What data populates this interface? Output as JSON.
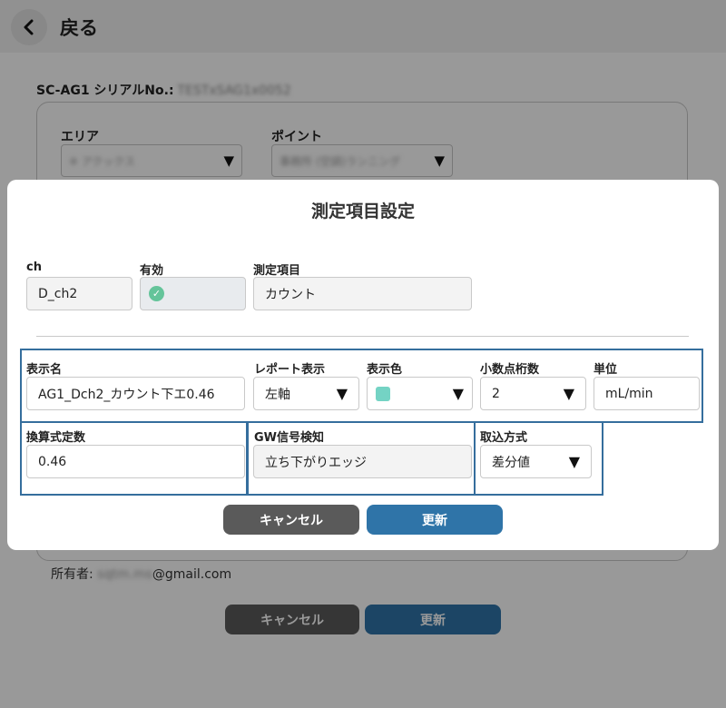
{
  "header": {
    "back_label": "戻る"
  },
  "background": {
    "serial_label": "SC-AG1 シリアルNo.:",
    "serial_value": "TESTxSAG1x0052",
    "area_label": "エリア",
    "area_value": "※ アクックス",
    "point_label": "ポイント",
    "point_value": "事務所 (空調)ランニング",
    "owner_label": "所有者:",
    "owner_local": "sqtm.ms",
    "owner_domain": "@gmail.com",
    "cancel_label": "キャンセル",
    "update_label": "更新"
  },
  "dialog": {
    "title": "測定項目設定",
    "ch": {
      "label": "ch",
      "value": "D_ch2"
    },
    "enabled": {
      "label": "有効",
      "checked": true
    },
    "item": {
      "label": "測定項目",
      "value": "カウント"
    },
    "display_name": {
      "label": "表示名",
      "value": "AG1_Dch2_カウント下エ0.46"
    },
    "report": {
      "label": "レポート表示",
      "value": "左軸"
    },
    "color": {
      "label": "表示色",
      "value": "#74d3c4"
    },
    "decimals": {
      "label": "小数点桁数",
      "value": "2"
    },
    "unit": {
      "label": "単位",
      "value": "mL/min"
    },
    "coefficient": {
      "label": "換算式定数",
      "value": "0.46"
    },
    "gw_signal": {
      "label": "GW信号検知",
      "value": "立ち下がりエッジ"
    },
    "capture": {
      "label": "取込方式",
      "value": "差分値"
    },
    "cancel_label": "キャンセル",
    "update_label": "更新"
  },
  "colors": {
    "primary": "#2f74a8",
    "cancel": "#5a5a5a",
    "check": "#64c49a",
    "highlight": "#356e9d"
  }
}
